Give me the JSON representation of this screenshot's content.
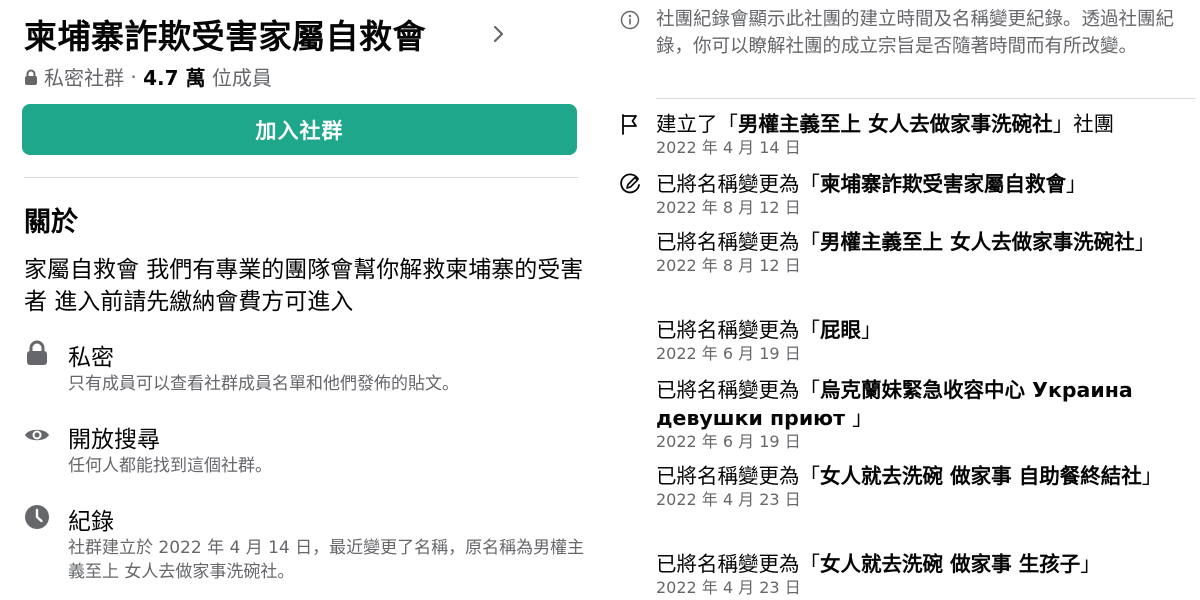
{
  "group": {
    "title": "柬埔寨詐欺受害家屬自救會",
    "privacy": "私密社群",
    "member_count": "4.7 萬",
    "member_suffix": "位成員",
    "join_button": "加入社群"
  },
  "about": {
    "heading": "關於",
    "description": "家屬自救會 我們有專業的團隊會幫你解救柬埔寨的受害者 進入前請先繳納會費方可進入",
    "items": [
      {
        "icon": "lock-icon",
        "title": "私密",
        "subtitle": "只有成員可以查看社群成員名單和他們發佈的貼文。"
      },
      {
        "icon": "eye-icon",
        "title": "開放搜尋",
        "subtitle": "任何人都能找到這個社群。"
      },
      {
        "icon": "clock-icon",
        "title": "紀錄",
        "subtitle": "社群建立於 2022 年 4 月 14 日，最近變更了名稱，原名稱為男權主義至上 女人去做家事洗碗社。"
      }
    ]
  },
  "history": {
    "info": "社團紀錄會顯示此社團的建立時間及名稱變更紀錄。透過社團紀錄，你可以瞭解社團的成立宗旨是否隨著時間而有所改變。",
    "entries": [
      {
        "icon": "flag-icon",
        "prefix": "建立了「",
        "name": "男權主義至上 女人去做家事洗碗社",
        "suffix": "」社團",
        "date": "2022 年 4 月 14 日"
      },
      {
        "icon": "edit-icon",
        "prefix": "已將名稱變更為「",
        "name": "柬埔寨詐欺受害家屬自救會",
        "suffix": "」",
        "date": "2022 年 8 月 12 日"
      },
      {
        "icon": "",
        "prefix": "已將名稱變更為「",
        "name": "男權主義至上 女人去做家事洗碗社",
        "suffix": "」",
        "date": "2022 年 8 月 12 日"
      },
      {
        "icon": "",
        "prefix": "已將名稱變更為「",
        "name": "屁眼",
        "suffix": "」",
        "date": "2022 年 6 月 19 日"
      },
      {
        "icon": "",
        "prefix": "已將名稱變更為「",
        "name": "烏克蘭妹緊急收容中心 Украина девушки приют ",
        "suffix": "」",
        "date": "2022 年 6 月 19 日"
      },
      {
        "icon": "",
        "prefix": "已將名稱變更為「",
        "name": "女人就去洗碗 做家事 自助餐終結社",
        "suffix": "」",
        "date": "2022 年 4 月 23 日"
      },
      {
        "icon": "",
        "prefix": "已將名稱變更為「",
        "name": "女人就去洗碗 做家事 生孩子",
        "suffix": "」",
        "date": "2022 年 4 月 23 日"
      }
    ]
  },
  "colors": {
    "join_button": "#1ea78a",
    "secondary_text": "#65676b",
    "primary_text": "#050505"
  }
}
